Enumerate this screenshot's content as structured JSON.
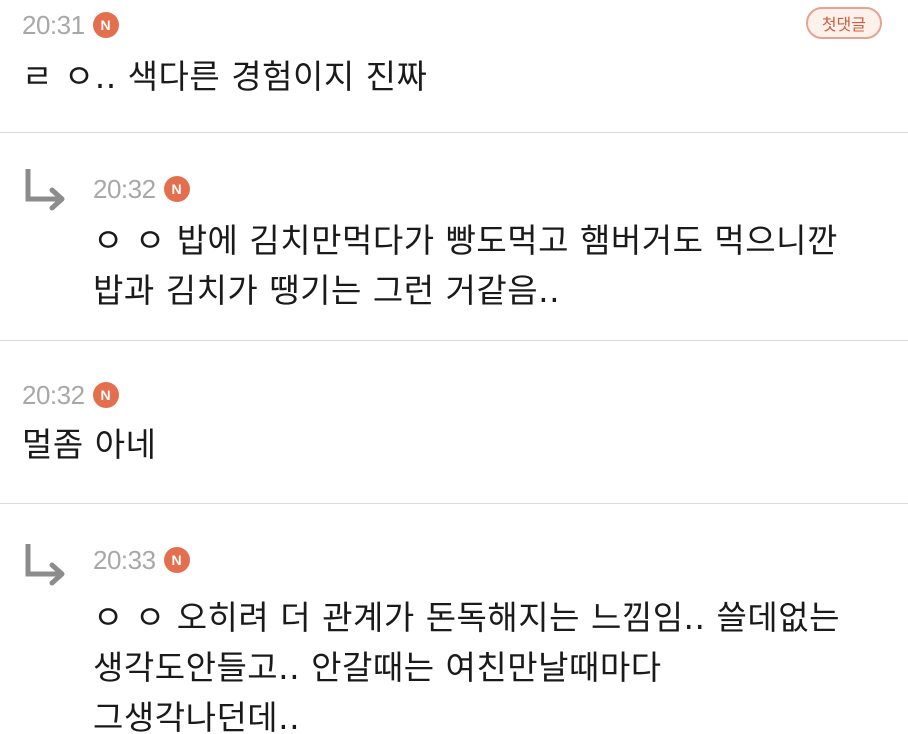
{
  "badges": {
    "new": "N",
    "first_comment": "첫댓글"
  },
  "comments": [
    {
      "time": "20:31",
      "is_reply": false,
      "lines": [
        "ㄹ ㅇ.. 색다른 경험이지 진짜"
      ]
    },
    {
      "time": "20:32",
      "is_reply": true,
      "lines": [
        "ㅇ ㅇ 밥에 김치만먹다가 빵도먹고 햄버거도 먹으니깐",
        "밥과 김치가 땡기는 그런 거같음.."
      ]
    },
    {
      "time": "20:32",
      "is_reply": false,
      "lines": [
        "멀좀 아네"
      ]
    },
    {
      "time": "20:33",
      "is_reply": true,
      "lines": [
        "ㅇ ㅇ 오히려 더 관계가 돈독해지는 느낌임.. 쓸데없는",
        "생각도안들고.. 안갈때는 여친만날때마다",
        "그생각나던데.."
      ]
    }
  ],
  "colors": {
    "new_badge": "#e36f4f",
    "time": "#a8a8a8",
    "divider": "#dcdcdc",
    "reply_arrow": "#8c8c8c"
  },
  "icons": {
    "reply": "reply-arrow-icon"
  }
}
